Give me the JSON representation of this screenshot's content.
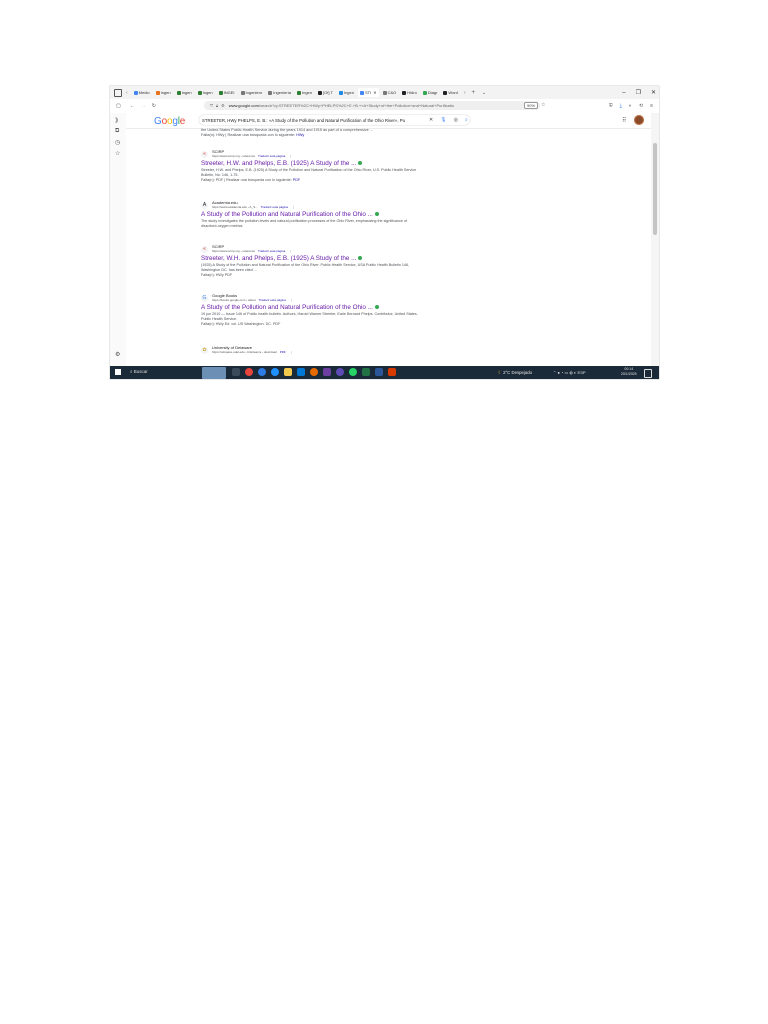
{
  "tabs": [
    {
      "label": "Medio",
      "color": "#4285f4"
    },
    {
      "label": "Ingen",
      "color": "#e8711a"
    },
    {
      "label": "Ingen",
      "color": "#2e7d32"
    },
    {
      "label": "Ingen",
      "color": "#2e7d32"
    },
    {
      "label": "INGEI",
      "color": "#2e7d32"
    },
    {
      "label": "Ingeniero",
      "color": "#777777"
    },
    {
      "label": "Ingeniería",
      "color": "#777777"
    },
    {
      "label": "Ingen",
      "color": "#2e7d32"
    },
    {
      "label": "[Of] T",
      "color": "#202124"
    },
    {
      "label": "Ingen",
      "color": "#1e88e5"
    },
    {
      "label": "STI",
      "color": "#4285f4",
      "active": true
    },
    {
      "label": "C&O",
      "color": "#777777"
    },
    {
      "label": "Hidro",
      "color": "#202124"
    },
    {
      "label": "Diagr",
      "color": "#34a853"
    },
    {
      "label": "Word",
      "color": "#202124"
    }
  ],
  "address": {
    "host": "www.google.com",
    "path": "/search?q=STREETER%2C+HWy+PHELPS%2C+E.+B.+«A+Study+of+the+Pollution+and+Natural+Purificatio",
    "zoom": "90%"
  },
  "search": {
    "logo": "Google",
    "query": "STREETER, HWy PHELPS, E. B.: «A Study of the Pollution and Natural Purification of the Ohio River», Pu"
  },
  "prev_snippet": {
    "line1": "the United States Public Health Service during the years 1914 and 1915 as part of a comprehensive ...",
    "line2_prefix": "Falta(n): HWy | Realizar una búsqueda con lo siguiente:",
    "line2_link": "HWy"
  },
  "results": [
    {
      "source": "SCIRP",
      "url": "https://www.scirp.org › reference",
      "translate": "Traducir esta página",
      "title": "Streeter, H.W. and Phelps, E.B. (1925) A Study of the ...",
      "snippet": "Streeter, H.W. and Phelps, E.B. (1925) A Study of the Pollution and Natural Purification of the Ohio River, U.S. Public Health Service Bulletin, No. 146, 1-75.",
      "missing_prefix": "Falta(n): PDF | Realizar una búsqueda con lo siguiente:",
      "missing_link": "PDF",
      "favicon": "«",
      "favicon_color": "#d93025"
    },
    {
      "source": "Academia.edu",
      "url": "https://www.academia.edu › A_S...",
      "translate": "Traducir esta página",
      "title": "A Study of the Pollution and Natural Purification of the Ohio ...",
      "snippet": "The study investigates the pollution levels and natural purification processes of the Ohio River, emphasizing the significance of dissolved-oxygen metrics.",
      "missing_prefix": "",
      "missing_link": "",
      "favicon": "A",
      "favicon_color": "#202124"
    },
    {
      "source": "SCIRP",
      "url": "https://www.scirp.org › reference",
      "translate": "Traducir esta página",
      "title": "Streeter, W.H. and Phelps, E.B. (1925) A Study of the ...",
      "snippet": "(1925) A Study of the Pollution and Natural Purification of the Ohio River. Public Health Service, USA Public Health Bulletin 146, Washington DC. has been cited ...",
      "missing_prefix": "Falta(n): HWy PDF",
      "missing_link": "",
      "favicon": "«",
      "favicon_color": "#d93025"
    },
    {
      "source": "Google Books",
      "url": "https://books.google.com › about",
      "translate": "Traducir esta página",
      "title": "A Study of the Pollution and Natural Purification of the Ohio ...",
      "snippet": "19 jun 2010 — Issue 146 of Public health bulletin. Authors, Harold Warner Streeter, Earle Bernard Phelps. Contributor, United States. Public Health Service.",
      "missing_prefix": "Falta(n): HWy Ed. vol. US Washington. DC. PDF",
      "missing_link": "",
      "favicon": "G",
      "favicon_color": "#4285f4"
    },
    {
      "source": "University of Delaware",
      "url": "https://udspace.udel.edu › bitstreams › download",
      "translate": "PDF",
      "title": "",
      "snippet": "",
      "missing_prefix": "",
      "missing_link": "",
      "favicon": "✿",
      "favicon_color": "#c9a227"
    }
  ],
  "taskbar": {
    "search_label": "Buscar",
    "weather": "2°C  Despejado",
    "lang": "ESP",
    "time": "00:14",
    "date": "20/1/2025"
  },
  "colors": {
    "link_visited": "#681da8",
    "link": "#1a0dab",
    "taskbar": "#1b2a38"
  }
}
